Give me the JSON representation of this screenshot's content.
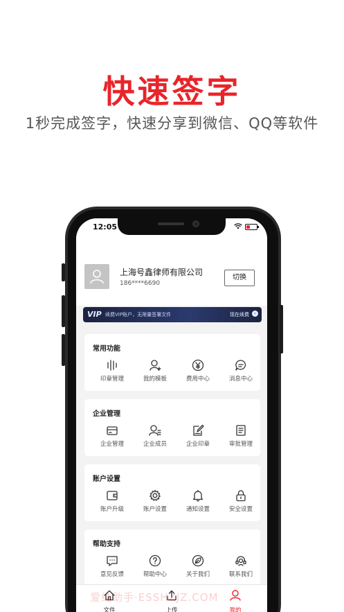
{
  "promo": {
    "title": "快速签字",
    "subtitle": "1秒完成签字，快速分享到微信、QQ等软件"
  },
  "status_bar": {
    "time": "12:05",
    "wifi_icon": "wifi-icon",
    "battery_level": 0.35,
    "battery_color": "#e8252a"
  },
  "profile": {
    "company": "上海号鑫律师有限公司",
    "phone": "186****6690",
    "switch_label": "切换"
  },
  "vip_banner": {
    "logo": "VIP",
    "text": "续费VIP账户，无限量签署文件",
    "action": "现在续费",
    "arrow": "›"
  },
  "sections": [
    {
      "title": "常用功能",
      "items": [
        {
          "label": "印章管理",
          "icon": "stamp-icon"
        },
        {
          "label": "我的模板",
          "icon": "template-icon"
        },
        {
          "label": "费用中心",
          "icon": "yen-icon"
        },
        {
          "label": "消息中心",
          "icon": "message-icon"
        }
      ]
    },
    {
      "title": "企业管理",
      "items": [
        {
          "label": "企业管理",
          "icon": "card-icon"
        },
        {
          "label": "企业成员",
          "icon": "member-icon"
        },
        {
          "label": "企业印章",
          "icon": "edit-icon"
        },
        {
          "label": "审批管理",
          "icon": "document-icon"
        }
      ]
    },
    {
      "title": "账户设置",
      "items": [
        {
          "label": "账户升级",
          "icon": "wallet-icon"
        },
        {
          "label": "账户设置",
          "icon": "gear-icon"
        },
        {
          "label": "通知设置",
          "icon": "bell-icon"
        },
        {
          "label": "安全设置",
          "icon": "lock-icon"
        }
      ]
    },
    {
      "title": "帮助支持",
      "items": [
        {
          "label": "意见反馈",
          "icon": "feedback-icon"
        },
        {
          "label": "帮助中心",
          "icon": "question-icon"
        },
        {
          "label": "关于我们",
          "icon": "leaf-icon"
        },
        {
          "label": "联系我们",
          "icon": "headset-icon"
        }
      ]
    }
  ],
  "tabbar": [
    {
      "label": "文件",
      "icon": "home-icon"
    },
    {
      "label": "上传",
      "icon": "upload-icon"
    },
    {
      "label": "我的",
      "icon": "user-icon",
      "active": true
    }
  ],
  "watermark": "爱纯助手·ESSHZJZ.COM",
  "colors": {
    "brand_red": "#e8252a",
    "vip_navy": "#1b2340"
  }
}
